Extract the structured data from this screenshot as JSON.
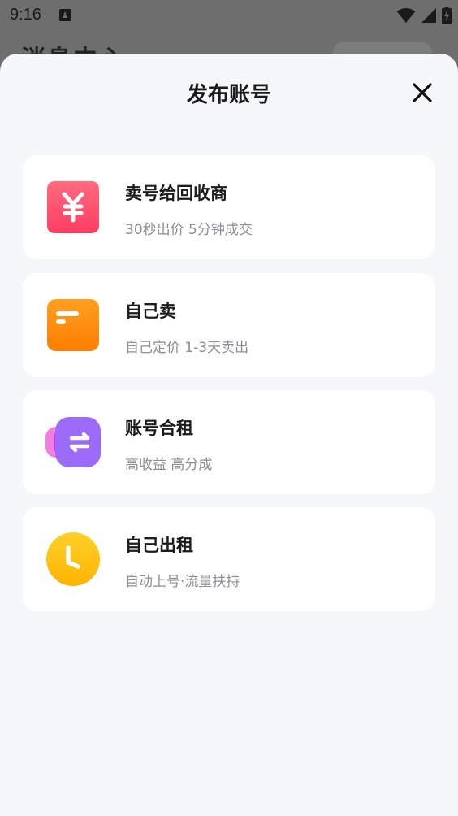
{
  "status_bar": {
    "time": "9:16",
    "icons": [
      "app-notification-icon",
      "wifi-icon",
      "cellular-signal-icon",
      "battery-charging-icon"
    ]
  },
  "background": {
    "title": "消息中心"
  },
  "sheet": {
    "title": "发布账号",
    "close_icon": "close-icon"
  },
  "options": [
    {
      "title": "卖号给回收商",
      "subtitle": "30秒出价 5分钟成交",
      "icon": "yuan-icon",
      "color": "#ff4d6a"
    },
    {
      "title": "自己卖",
      "subtitle": "自己定价 1-3天卖出",
      "icon": "document-icon",
      "color": "#ff8a00"
    },
    {
      "title": "账号合租",
      "subtitle": "高收益 高分成",
      "icon": "swap-icon",
      "color": "#8b63f5"
    },
    {
      "title": "自己出租",
      "subtitle": "自动上号·流量扶持",
      "icon": "clock-icon",
      "color": "#ffc21a"
    }
  ]
}
